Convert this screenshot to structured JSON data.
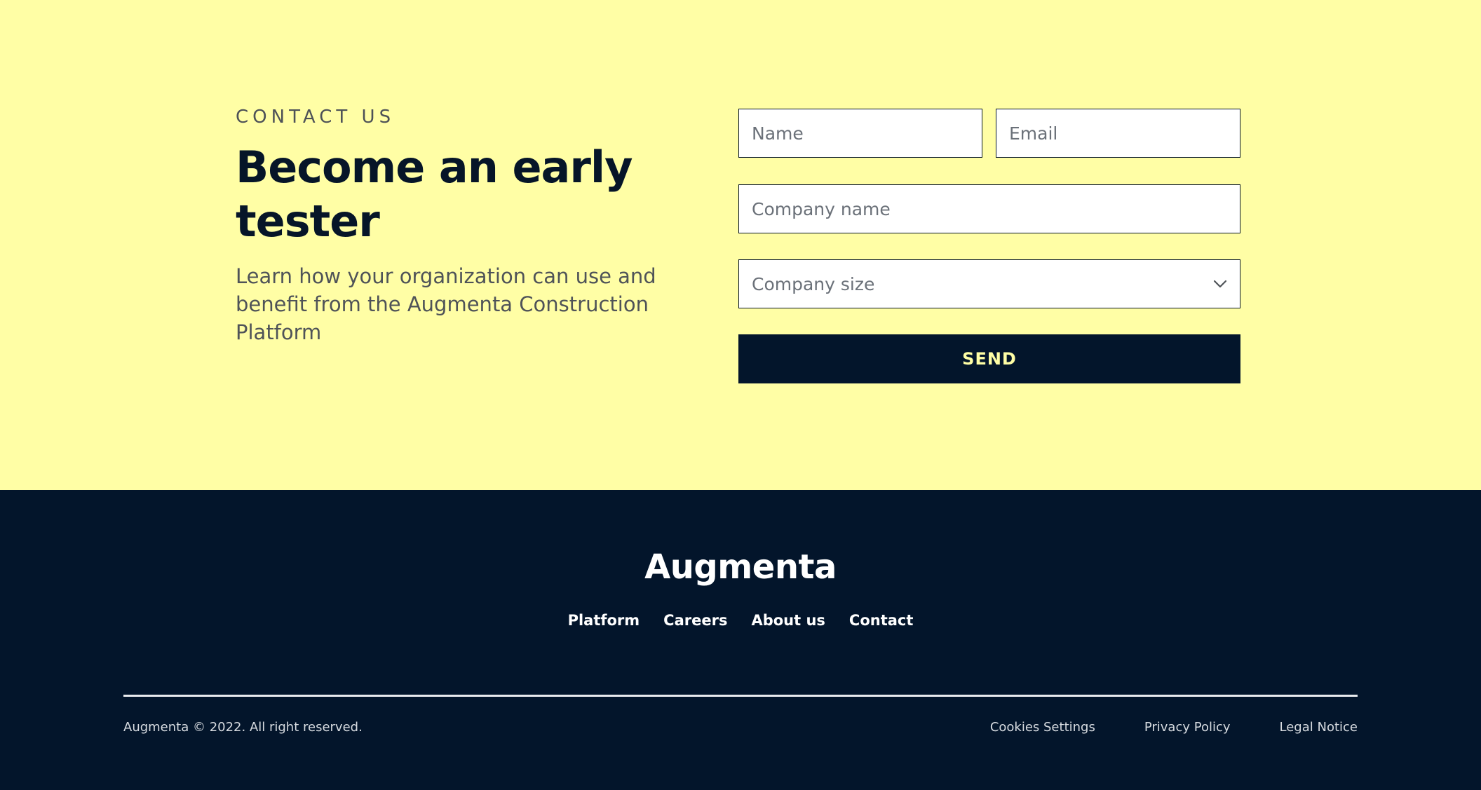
{
  "contact": {
    "eyebrow": "CONTACT US",
    "headline": "Become an early tester",
    "lead": "Learn how your organization can use and benefit from the Augmenta Construction Platform",
    "form": {
      "name_placeholder": "Name",
      "email_placeholder": "Email",
      "company_placeholder": "Company name",
      "size_placeholder": "Company size",
      "send_label": "SEND"
    }
  },
  "footer": {
    "logo": "Augmenta",
    "nav": [
      "Platform",
      "Careers",
      "About us",
      "Contact"
    ],
    "copyright": "Augmenta © 2022. All right reserved.",
    "legal": [
      "Cookies Settings",
      "Privacy Policy",
      "Legal Notice"
    ]
  },
  "icons": {
    "select_chevron": "chevron-down-icon"
  },
  "colors": {
    "contact_background": "#fffea5",
    "footer_background": "#03152b",
    "send_button_text": "#fffea5",
    "headline": "#061528"
  }
}
